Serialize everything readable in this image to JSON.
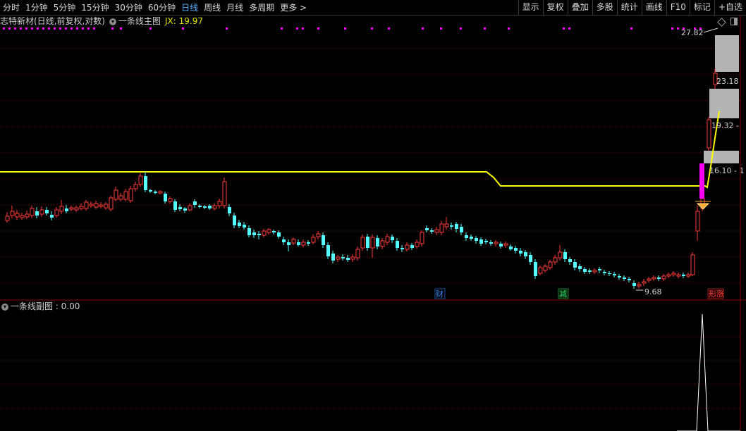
{
  "toolbar": {
    "periods": [
      "分时",
      "1分钟",
      "5分钟",
      "15分钟",
      "30分钟",
      "60分钟",
      "日线",
      "周线",
      "月线",
      "多周期",
      "更多 >"
    ],
    "active_period": "日线",
    "tools": [
      "显示",
      "复权",
      "叠加",
      "多股",
      "统计",
      "画线",
      "F10",
      "标记",
      "+自选"
    ]
  },
  "main_chart": {
    "stock_title": "志特新材(日线,前复权,对数)",
    "indicator_name": "一条线主图",
    "jx_label": "JX: 19.97",
    "high_label": "27.82",
    "low_label": "9.68",
    "level_labels": [
      "23.18",
      "19.32 -",
      "16.10 - 1"
    ],
    "event_tags": [
      {
        "text": "财",
        "color": "#3a8cff"
      },
      {
        "text": "减",
        "color": "#2fd35a"
      },
      {
        "text": "形涨",
        "color": "#ff4040"
      }
    ]
  },
  "sub_chart": {
    "title": "一条线副图 : 0.00"
  },
  "colors": {
    "up": "#ff3b3b",
    "down": "#54ffff",
    "jx_line": "#ffff00",
    "magenta": "#ff00ff",
    "grid": "#8b0000",
    "zone": "#b4b4b4"
  }
}
